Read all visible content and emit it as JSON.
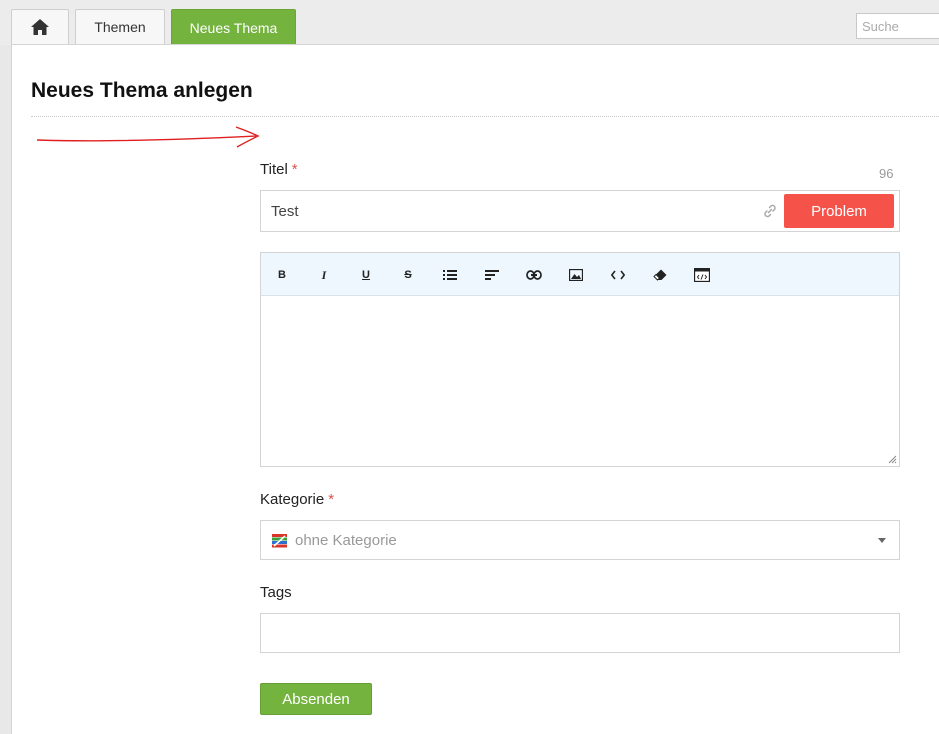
{
  "tabs": {
    "home_icon": "home-icon",
    "themen": "Themen",
    "new_topic": "Neues Thema"
  },
  "search": {
    "placeholder": "Suche"
  },
  "page": {
    "title": "Neues Thema anlegen"
  },
  "form": {
    "title_label": "Titel",
    "required_mark": "*",
    "title_counter": "96",
    "title_value": "Test",
    "prefix_button": "Problem",
    "toolbar": [
      "bold-icon",
      "italic-icon",
      "underline-icon",
      "strikethrough-icon",
      "list-icon",
      "align-left-icon",
      "link-icon",
      "image-icon",
      "code-icon",
      "eraser-icon",
      "source-icon"
    ],
    "category_label": "Kategorie",
    "category_value": "ohne Kategorie",
    "tags_label": "Tags",
    "submit_label": "Absenden"
  },
  "colors": {
    "accent_green": "#75b33f",
    "problem_red": "#f5534a",
    "required_red": "#d9534f",
    "toolbar_bg": "#edf7fd",
    "annotation_arrow": "#e02020"
  }
}
